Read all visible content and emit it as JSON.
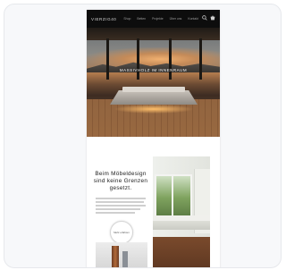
{
  "site": {
    "logo": "VIERZIG40",
    "nav": [
      "Shop",
      "Betten",
      "Projekte",
      "Über uns",
      "Kontakt"
    ],
    "hero_title": "MASSIVHOLZ IM INNENRAUM",
    "headline": "Beim Möbeldesign sind keine Grenzen gesetzt.",
    "circle_button": "Mehr erfahren"
  },
  "icons": {
    "search": "search-icon",
    "cart": "cart-icon"
  },
  "colors": {
    "topbar": "#0d0d0d",
    "card": "#f7f8fa",
    "accent_wood": "#9a6a42"
  }
}
